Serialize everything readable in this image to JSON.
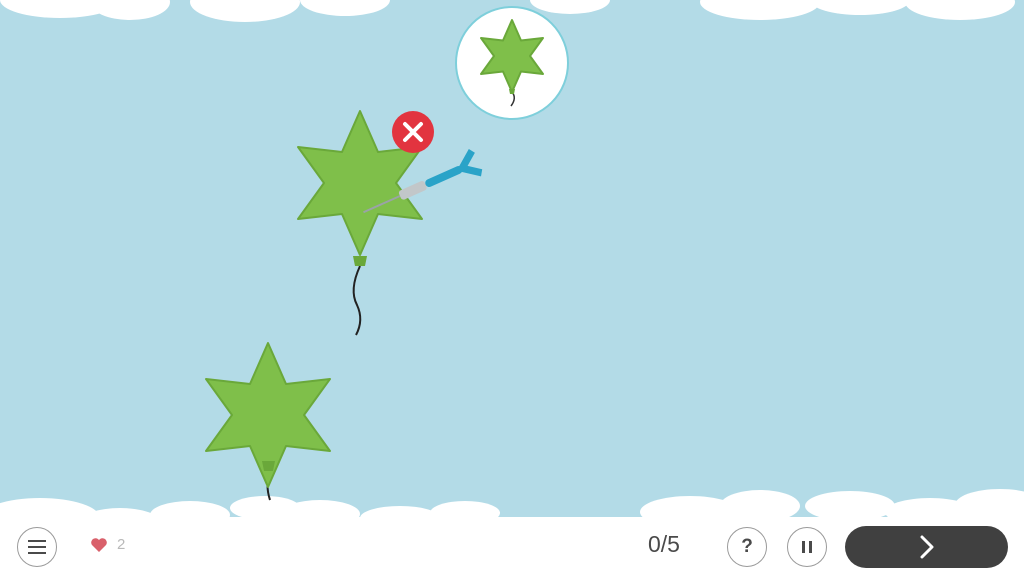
{
  "target": {
    "shape": "six-point-star",
    "color": "#7fbf4a"
  },
  "balloons": [
    {
      "shape": "six-point-star",
      "color": "#7fbf4a",
      "state": "hit-wrong"
    },
    {
      "shape": "six-point-star",
      "color": "#7fbf4a",
      "state": "floating"
    }
  ],
  "feedback": {
    "icon": "wrong-x-icon",
    "color": "#e2343f"
  },
  "dart": {
    "color": "#2aa3c8"
  },
  "toolbar": {
    "lives": "2",
    "score": "0/5",
    "help_label": "?"
  },
  "colors": {
    "sky": "#b3dbe7",
    "balloon": "#7fbf4a",
    "next_button": "#404040"
  }
}
